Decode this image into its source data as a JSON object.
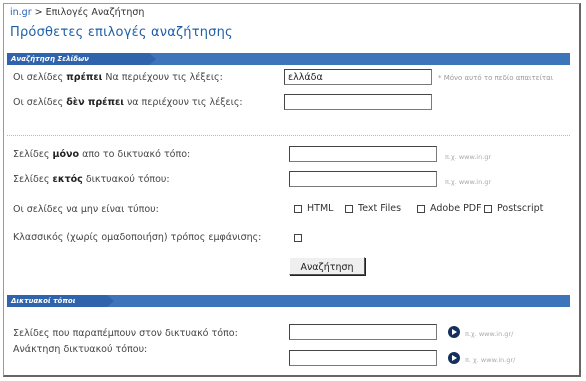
{
  "breadcrumb": {
    "home": "in.gr",
    "separator": ">",
    "current": "Επιλογές Αναζήτηση"
  },
  "page_title": "Πρόσθετες επιλογές αναζήτησης",
  "section_pages": {
    "header": "Αναζήτηση Σελίδων",
    "must_contain": {
      "label_pre": "Οι σελίδες ",
      "label_bold": "πρέπει",
      "label_post": " Να περιέχουν τις λέξεις:",
      "value": "ελλάδα",
      "required_note": "* Μόνο αυτό το πεδίο απαιτείται"
    },
    "must_not_contain": {
      "label_pre": "Οι σελίδες ",
      "label_bold": "δὲν πρέπει",
      "label_post": " να περιέχουν τις λέξεις:",
      "value": ""
    },
    "only_site": {
      "label_pre": "Σελίδες ",
      "label_bold": "μόνο",
      "label_post": " απο το δικτυακό τόπο:",
      "value": "",
      "hint": "π.χ. www.in.gr"
    },
    "except_site": {
      "label_pre": "Σελίδες ",
      "label_bold": "εκτός",
      "label_post": " δικτυακού τόπου:",
      "value": "",
      "hint": "π.χ. www.in.gr"
    },
    "exclude_types": {
      "label": "Οι σελίδες να μην είναι τύπου:",
      "options": [
        "HTML",
        "Text Files",
        "Adobe PDF",
        "Postscript"
      ]
    },
    "classic_mode": {
      "label": "Κλασσικός (χωρίς ομαδοποιήση) τρόπος εμφάνισης:"
    },
    "search_button": "Αναζήτηση"
  },
  "section_sites": {
    "header": "Δικτυακοί τόποι",
    "linking_to": {
      "label": "Σελίδες που παραπέμπουν στον δικτυακό τόπο:",
      "value": "",
      "hint": "π.χ. www.in.gr/"
    },
    "site_lookup": {
      "label": "Ανάκτηση δικτυακού τόπου:",
      "value": "",
      "hint": "π. χ. www.in.gr/"
    }
  }
}
